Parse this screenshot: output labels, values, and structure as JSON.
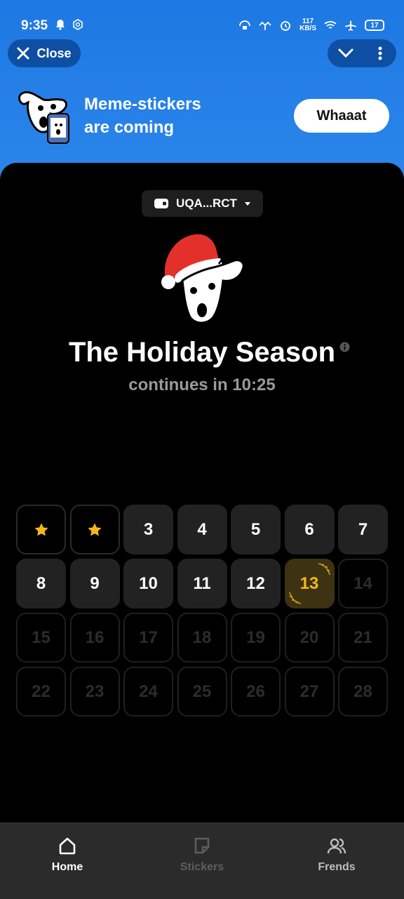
{
  "status_bar": {
    "time": "9:35",
    "net_speed_value": "117",
    "net_speed_unit": "KB/S",
    "battery": "17",
    "icons": [
      "bell-icon",
      "hex-icon",
      "vpn-icon",
      "signal-icon",
      "alarm-icon",
      "wifi-icon",
      "airplane-icon",
      "battery-icon"
    ]
  },
  "top_bar": {
    "close_label": "Close",
    "icons": [
      "close-icon",
      "chevron-down-icon",
      "more-vertical-icon"
    ]
  },
  "banner": {
    "line1": "Meme-stickers",
    "line2": "are coming",
    "button_label": "Whaaat"
  },
  "wallet": {
    "address": "UQA...RCT"
  },
  "hero": {
    "title": "The Holiday Season",
    "subtitle": "continues in 10:25"
  },
  "calendar": {
    "days": [
      {
        "label": "",
        "state": "done"
      },
      {
        "label": "",
        "state": "done"
      },
      {
        "label": "3",
        "state": "open"
      },
      {
        "label": "4",
        "state": "open"
      },
      {
        "label": "5",
        "state": "open"
      },
      {
        "label": "6",
        "state": "open"
      },
      {
        "label": "7",
        "state": "open"
      },
      {
        "label": "8",
        "state": "open"
      },
      {
        "label": "9",
        "state": "open"
      },
      {
        "label": "10",
        "state": "open"
      },
      {
        "label": "11",
        "state": "open"
      },
      {
        "label": "12",
        "state": "open"
      },
      {
        "label": "13",
        "state": "today"
      },
      {
        "label": "14",
        "state": "locked"
      },
      {
        "label": "15",
        "state": "locked"
      },
      {
        "label": "16",
        "state": "locked"
      },
      {
        "label": "17",
        "state": "locked"
      },
      {
        "label": "18",
        "state": "locked"
      },
      {
        "label": "19",
        "state": "locked"
      },
      {
        "label": "20",
        "state": "locked"
      },
      {
        "label": "21",
        "state": "locked"
      },
      {
        "label": "22",
        "state": "locked"
      },
      {
        "label": "23",
        "state": "locked"
      },
      {
        "label": "24",
        "state": "locked"
      },
      {
        "label": "25",
        "state": "locked"
      },
      {
        "label": "26",
        "state": "locked"
      },
      {
        "label": "27",
        "state": "locked"
      },
      {
        "label": "28",
        "state": "locked"
      }
    ]
  },
  "nav": {
    "home": "Home",
    "stickers": "Stickers",
    "friends": "Frends"
  },
  "colors": {
    "header_blue": "#1e78e3",
    "accent_gold": "#f5b71a"
  }
}
